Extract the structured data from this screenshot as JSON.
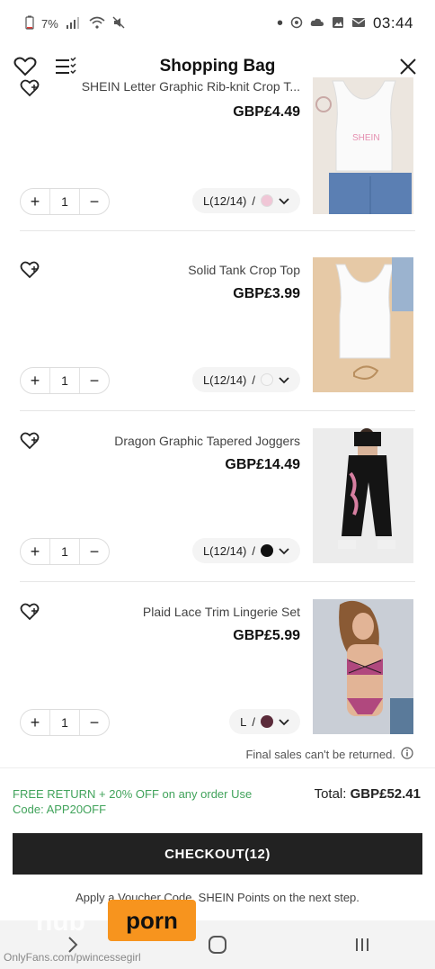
{
  "status_bar": {
    "time": "03:44",
    "battery": "7%",
    "dot": "•"
  },
  "header": {
    "title": "Shopping Bag"
  },
  "items": [
    {
      "title": "SHEIN Letter Graphic Rib-knit Crop T...",
      "price": "GBP£4.49",
      "variant": "L(12/14)",
      "variant_sep": "/",
      "swatch_color": "#f0c6d6",
      "quantity": "1",
      "image_desc": "tank-white-pink-letters"
    },
    {
      "title": "Solid Tank Crop Top",
      "price": "GBP£3.99",
      "variant": "L(12/14)",
      "variant_sep": "/",
      "swatch_color": "#f6f6f6",
      "quantity": "1",
      "image_desc": "white-tank"
    },
    {
      "title": "Dragon Graphic Tapered Joggers",
      "price": "GBP£14.49",
      "variant": "L(12/14)",
      "variant_sep": "/",
      "swatch_color": "#111111",
      "quantity": "1",
      "image_desc": "black-joggers"
    },
    {
      "title": "Plaid Lace Trim Lingerie Set",
      "price": "GBP£5.99",
      "variant": "L",
      "variant_sep": "/",
      "swatch_color": "#5b2b3a",
      "quantity": "1",
      "image_desc": "plaid-lingerie"
    }
  ],
  "final_sale_note": "Final sales can't be returned.",
  "checkout": {
    "total_label": "Total:",
    "total_value": "GBP£52.41",
    "promo_line1": "FREE RETURN + 20% OFF on any order Use",
    "promo_line2": "Code: APP20OFF",
    "button_label": "CHECKOUT(12)",
    "voucher_note": "Apply a Voucher Code, SHEIN Points on the next step."
  },
  "watermark": {
    "logo_text": "porn",
    "url_text": "OnlyFans.com/pwincessegirl",
    "ghost_text": "hub"
  },
  "colors": {
    "promo_green": "#41a35b",
    "checkout_bg": "#222222",
    "watermark_orange": "#f7941e"
  }
}
